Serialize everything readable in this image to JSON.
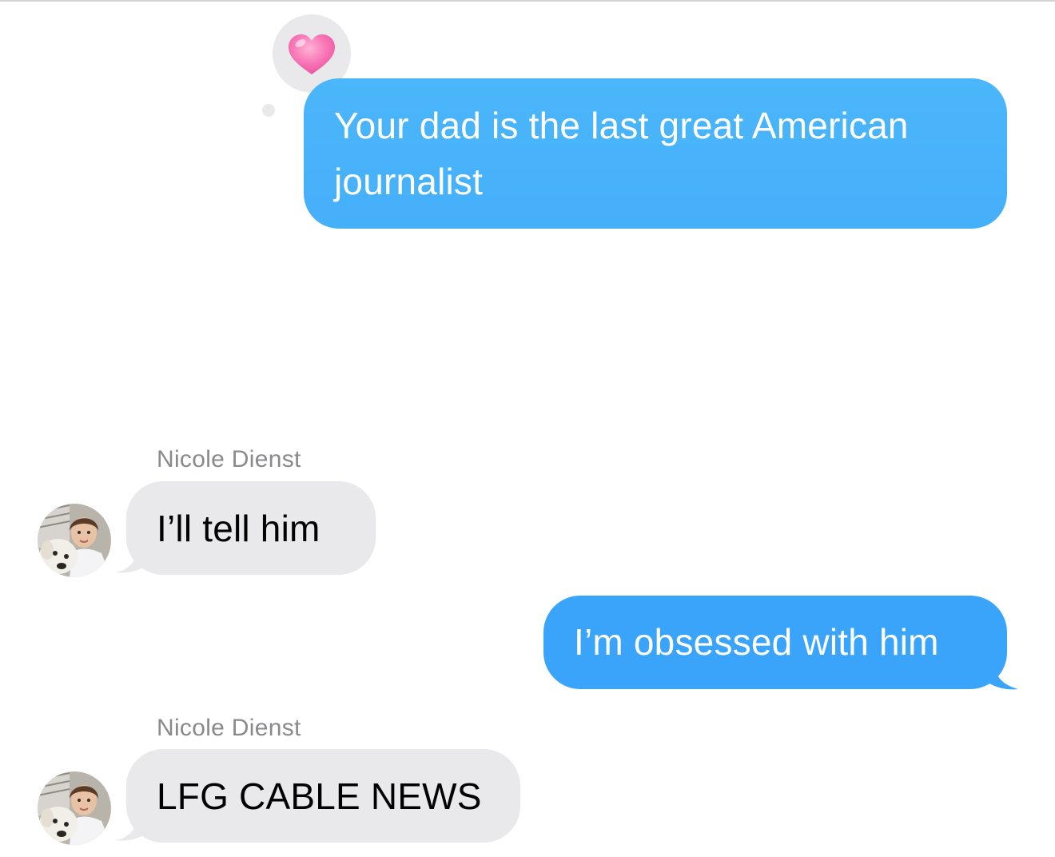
{
  "conversation": {
    "messages": [
      {
        "direction": "outgoing",
        "text": "Your dad is the last great American journalist",
        "reaction": "heart-icon",
        "bubble_color": "#4bb6fa"
      },
      {
        "direction": "incoming",
        "sender": "Nicole Dienst",
        "text": "I’ll tell him",
        "avatar": "contact-photo-avatar",
        "bubble_color": "#e9e9eb"
      },
      {
        "direction": "outgoing",
        "text": "I’m obsessed with him",
        "bubble_color": "#3aa4fb"
      },
      {
        "direction": "incoming",
        "sender": "Nicole Dienst",
        "text": "LFG CABLE NEWS",
        "avatar": "contact-photo-avatar",
        "bubble_color": "#e9e9eb"
      }
    ]
  },
  "colors": {
    "outgoing_text": "#ffffff",
    "incoming_text": "#000000",
    "sender_name": "#8a8a8e",
    "reaction_heart": "#f472b6"
  }
}
